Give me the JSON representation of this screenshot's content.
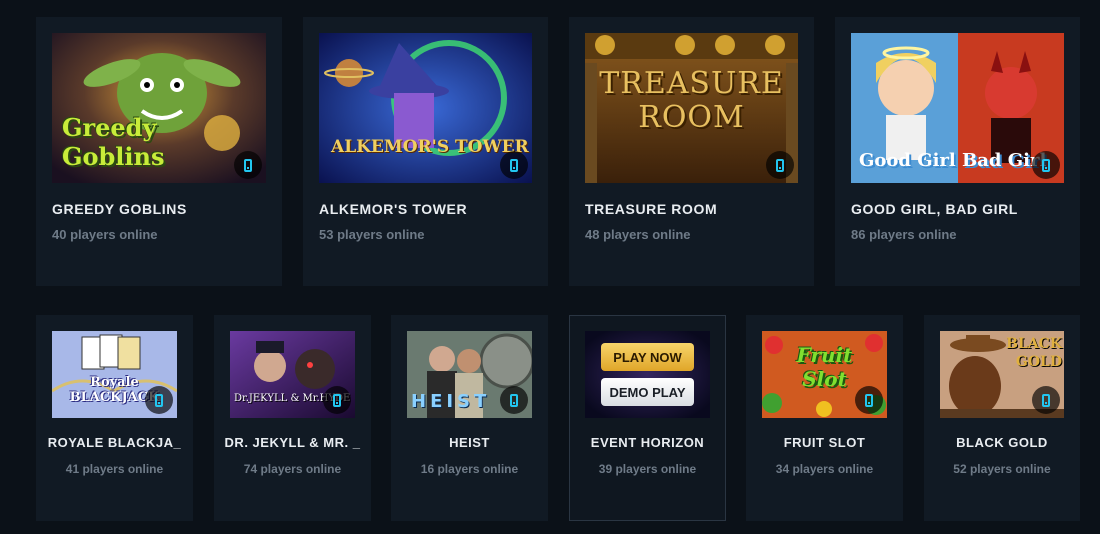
{
  "top_games": [
    {
      "title": "GREEDY GOBLINS",
      "players": "40 players online",
      "art_text": "Greedy Goblins"
    },
    {
      "title": "ALKEMOR'S TOWER",
      "players": "53 players online",
      "art_text": "ALKEMOR'S TOWER"
    },
    {
      "title": "TREASURE ROOM",
      "players": "48 players online",
      "art_text": "TREASURE ROOM"
    },
    {
      "title": "GOOD GIRL, BAD GIRL",
      "players": "86 players online",
      "art_text": "Good Girl Bad Girl"
    }
  ],
  "bottom_games": [
    {
      "title": "ROYALE BLACKJA_",
      "players": "41 players online",
      "art_text": "Royale BLACKJACK"
    },
    {
      "title": "DR. JEKYLL & MR. _",
      "players": "74 players online",
      "art_text": "Dr.JEKYLL & Mr.HYDE"
    },
    {
      "title": "HEIST",
      "players": "16 players online",
      "art_text": "HEIST"
    },
    {
      "title": "EVENT HORIZON",
      "players": "39 players online",
      "play_now": "PLAY NOW",
      "demo_play": "DEMO PLAY"
    },
    {
      "title": "FRUIT SLOT",
      "players": "34 players online",
      "art_text": "Fruit Slot"
    },
    {
      "title": "BLACK GOLD",
      "players": "52 players online",
      "art_text": "BLACK GOLD"
    }
  ],
  "icons": {
    "mobile": "mobile-phone-icon"
  },
  "colors": {
    "background": "#0b1118",
    "card": "#111a24",
    "mobile_icon": "#22c6f0",
    "play_button": "#f0c24a"
  }
}
